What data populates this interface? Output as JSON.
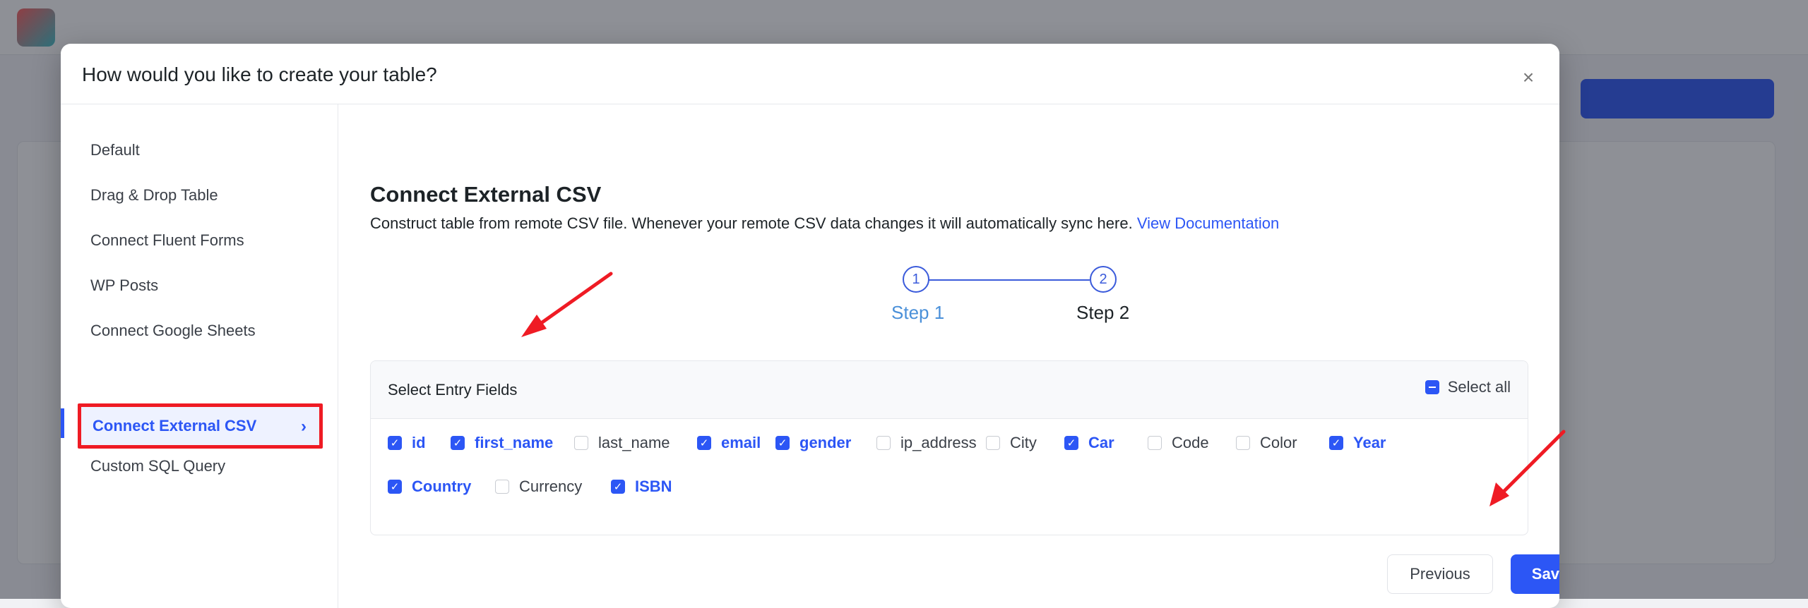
{
  "background": {
    "app_name": "",
    "nav": [
      "",
      "",
      ""
    ],
    "page_title": "",
    "create_button": ""
  },
  "modal": {
    "title": "How would you like to create your table?",
    "close_icon": "close-icon",
    "sidebar": {
      "items": [
        {
          "label": "Default"
        },
        {
          "label": "Drag & Drop Table"
        },
        {
          "label": "Connect Fluent Forms"
        },
        {
          "label": "WP Posts"
        },
        {
          "label": "Connect Google Sheets"
        },
        {
          "label": "Connect External CSV",
          "active": true
        },
        {
          "label": "Custom SQL Query"
        }
      ]
    },
    "content": {
      "title": "Connect External CSV",
      "description": "Construct table from remote CSV file. Whenever your remote CSV data changes it will automatically sync here.",
      "doc_link": "View Documentation",
      "steps": [
        {
          "number": "1",
          "label": "Step 1",
          "active": true
        },
        {
          "number": "2",
          "label": "Step 2",
          "active": false
        }
      ],
      "fields_heading": "Select Entry Fields",
      "select_all_label": "Select all",
      "fields": [
        {
          "label": "id",
          "checked": true
        },
        {
          "label": "first_name",
          "checked": true
        },
        {
          "label": "last_name",
          "checked": false
        },
        {
          "label": "email",
          "checked": true
        },
        {
          "label": "gender",
          "checked": true
        },
        {
          "label": "ip_address",
          "checked": false
        },
        {
          "label": "City",
          "checked": false
        },
        {
          "label": "Car",
          "checked": true
        },
        {
          "label": "Code",
          "checked": false
        },
        {
          "label": "Color",
          "checked": false
        },
        {
          "label": "Year",
          "checked": true
        },
        {
          "label": "Country",
          "checked": true
        },
        {
          "label": "Currency",
          "checked": false
        },
        {
          "label": "ISBN",
          "checked": true
        }
      ],
      "buttons": {
        "previous": "Previous",
        "save": "Save"
      }
    }
  },
  "colors": {
    "accent": "#2c56f5",
    "highlight_border": "#ef1b24",
    "annotation_arrow": "#ef1b24"
  }
}
